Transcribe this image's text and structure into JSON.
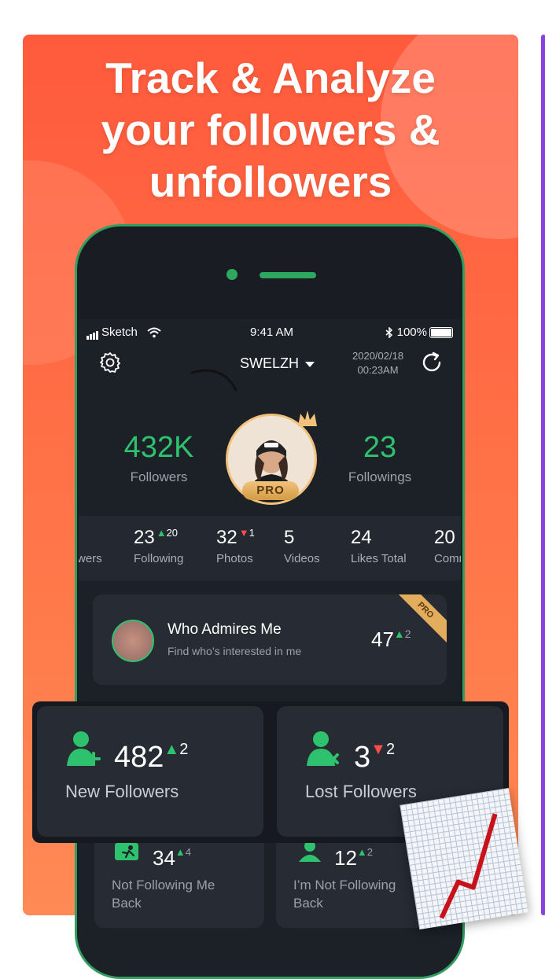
{
  "headline": {
    "line1": "Track & Analyze",
    "line2": "your followers &",
    "line3": "unfollowers"
  },
  "status_bar": {
    "carrier": "Sketch",
    "time": "9:41 AM",
    "battery": "100%"
  },
  "header": {
    "username": "SWELZH",
    "date": "2020/02/18",
    "time": "00:23AM"
  },
  "profile": {
    "followers": {
      "value": "432K",
      "label": "Followers"
    },
    "followings": {
      "value": "23",
      "label": "Followings"
    },
    "badge": "PRO"
  },
  "stats_strip": [
    {
      "value": "",
      "delta": "",
      "label": "wers"
    },
    {
      "value": "23",
      "delta": "20",
      "direction": "up",
      "label": "Following"
    },
    {
      "value": "32",
      "delta": "1",
      "direction": "down",
      "label": "Photos"
    },
    {
      "value": "5",
      "delta": "",
      "label": "Videos"
    },
    {
      "value": "24",
      "delta": "",
      "label": "Likes Total"
    },
    {
      "value": "20",
      "delta": "",
      "label": "Comm"
    }
  ],
  "admire": {
    "title": "Who Admires Me",
    "subtitle": "Find who’s interested in me",
    "count": "47",
    "delta": "2",
    "ribbon": "PRO"
  },
  "overlay_cards": {
    "new": {
      "count": "482",
      "delta": "2",
      "label": "New Followers"
    },
    "lost": {
      "count": "3",
      "delta": "2",
      "label": "Lost Followers"
    }
  },
  "bottom_cards": {
    "not_following_me": {
      "count": "34",
      "delta": "4",
      "line1": "Not Following Me",
      "line2": "Back"
    },
    "im_not_following": {
      "count": "12",
      "delta": "2",
      "line1": "I’m Not Following",
      "line2": "Back"
    }
  },
  "colors": {
    "accent_green": "#2fc26e",
    "brand_orange": "#ff5a3c",
    "down_red": "#ff4b4b"
  }
}
